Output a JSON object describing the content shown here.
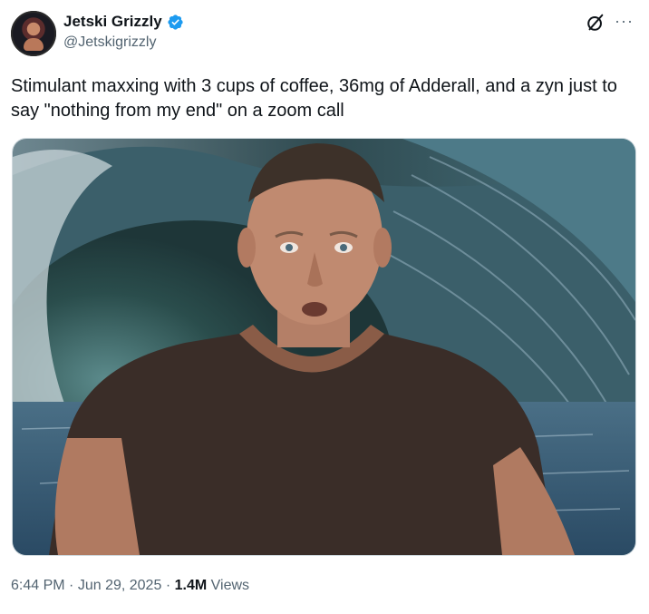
{
  "author": {
    "display_name": "Jetski Grizzly",
    "handle": "@Jetskigrizzly",
    "verified": true
  },
  "tweet": {
    "text": "Stimulant maxxing with 3 cups of coffee, 36mg of Adderall, and a zyn just to say \"nothing from my end\" on a zoom call"
  },
  "meta": {
    "time": "6:44 PM",
    "separator": "·",
    "date": "Jun 29, 2025",
    "views_count": "1.4M",
    "views_label": "Views"
  },
  "icons": {
    "verified": "verified-badge-icon",
    "grok": "grok-icon",
    "more": "more-options-icon"
  },
  "colors": {
    "verified_blue": "#1d9bf0",
    "secondary_text": "#536471",
    "primary_text": "#0f1419"
  }
}
